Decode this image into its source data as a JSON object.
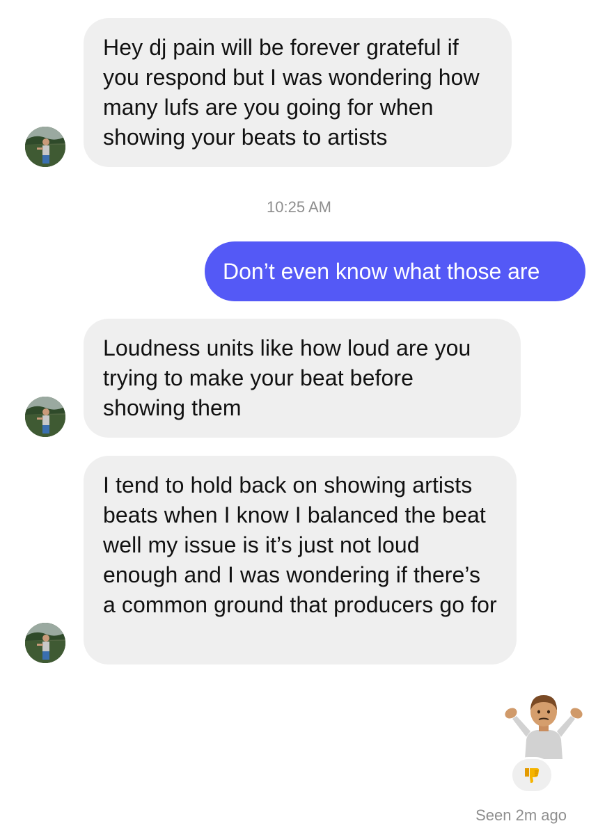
{
  "conversation": {
    "messages": [
      {
        "sender": "them",
        "text": "Hey dj pain will be forever grateful if you respond but I was wondering how many lufs are you going for when showing your beats to artists"
      },
      {
        "sender": "me",
        "text": "Don’t even know what those are"
      },
      {
        "sender": "them",
        "text": "Loudness units like how loud are you trying to make your beat before showing them"
      },
      {
        "sender": "them",
        "text": "I tend to hold back on showing artists beats when I know I balanced the beat well my issue is it’s just not loud enough and I was wondering if there’s a common ground that producers go for"
      },
      {
        "sender": "me",
        "emoji": "person-shrugging-emoji"
      }
    ],
    "timestamp": "10:25 AM",
    "reaction": "thumbs-down-emoji",
    "seen_status": "Seen 2m ago"
  },
  "colors": {
    "outgoing_bubble": "#5459f6",
    "incoming_bubble": "#efefef",
    "meta_text": "#8e8e8e"
  }
}
